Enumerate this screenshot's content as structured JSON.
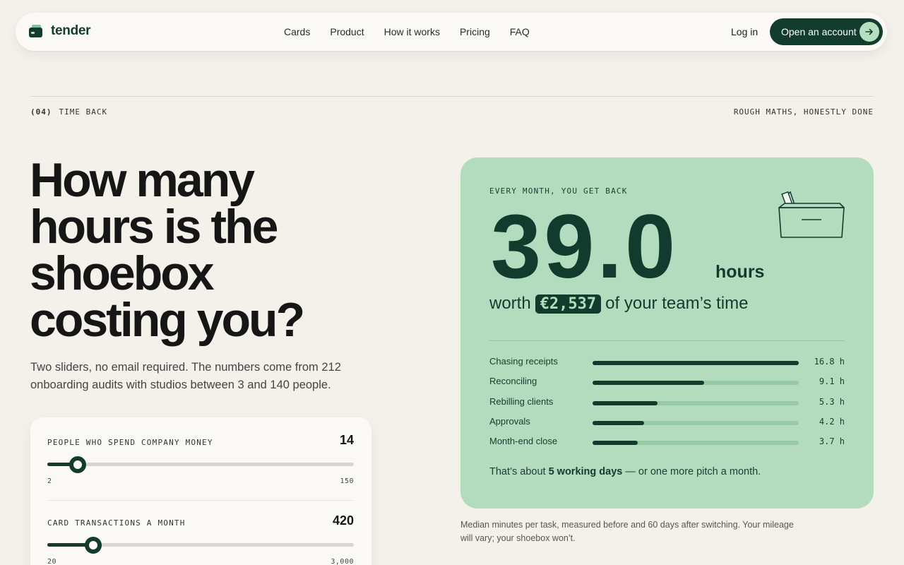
{
  "nav": {
    "brand": "tender",
    "links": [
      "Cards",
      "Product",
      "How it works",
      "Pricing",
      "FAQ"
    ],
    "login": "Log in",
    "cta": "Open an account"
  },
  "section": {
    "number": "(04)",
    "name": "TIME BACK",
    "right_note": "ROUGH MATHS, HONESTLY DONE"
  },
  "hero": {
    "headline_lines": [
      "How many",
      "hours is the",
      "shoebox",
      "costing you?"
    ],
    "subtitle": "Two sliders, no email required. The numbers come from 212 onboarding audits with studios between 3 and 140 people."
  },
  "sliders": [
    {
      "label": "PEOPLE WHO SPEND COMPANY MONEY",
      "value": "14",
      "min": "2",
      "max": "150",
      "fraction": 0.1
    },
    {
      "label": "CARD TRANSACTIONS A MONTH",
      "value": "420",
      "min": "20",
      "max": "3,000",
      "fraction": 0.15
    }
  ],
  "result": {
    "eyebrow": "EVERY MONTH, YOU GET BACK",
    "hours": "39.0",
    "unit": "hours",
    "worth_prefix": "worth",
    "money": "€2,537",
    "worth_suffix": "of your team’s time",
    "breakdown": [
      {
        "label": "Chasing receipts",
        "value": "16.8 h",
        "fraction": 1.0
      },
      {
        "label": "Reconciling",
        "value": "9.1 h",
        "fraction": 0.54
      },
      {
        "label": "Rebilling clients",
        "value": "5.3 h",
        "fraction": 0.315
      },
      {
        "label": "Approvals",
        "value": "4.2 h",
        "fraction": 0.25
      },
      {
        "label": "Month-end close",
        "value": "3.7 h",
        "fraction": 0.22
      }
    ],
    "footer_prefix": "That’s about",
    "footer_bold": "5 working days",
    "footer_suffix": "— or one more pitch a month."
  },
  "note": "Median minutes per task, measured before and 60 days after switching. Your mileage will vary; your shoebox won’t.",
  "colors": {
    "brand_dark": "#123d2e",
    "mint": "#b3dcbe",
    "background": "#f3f1ea"
  }
}
